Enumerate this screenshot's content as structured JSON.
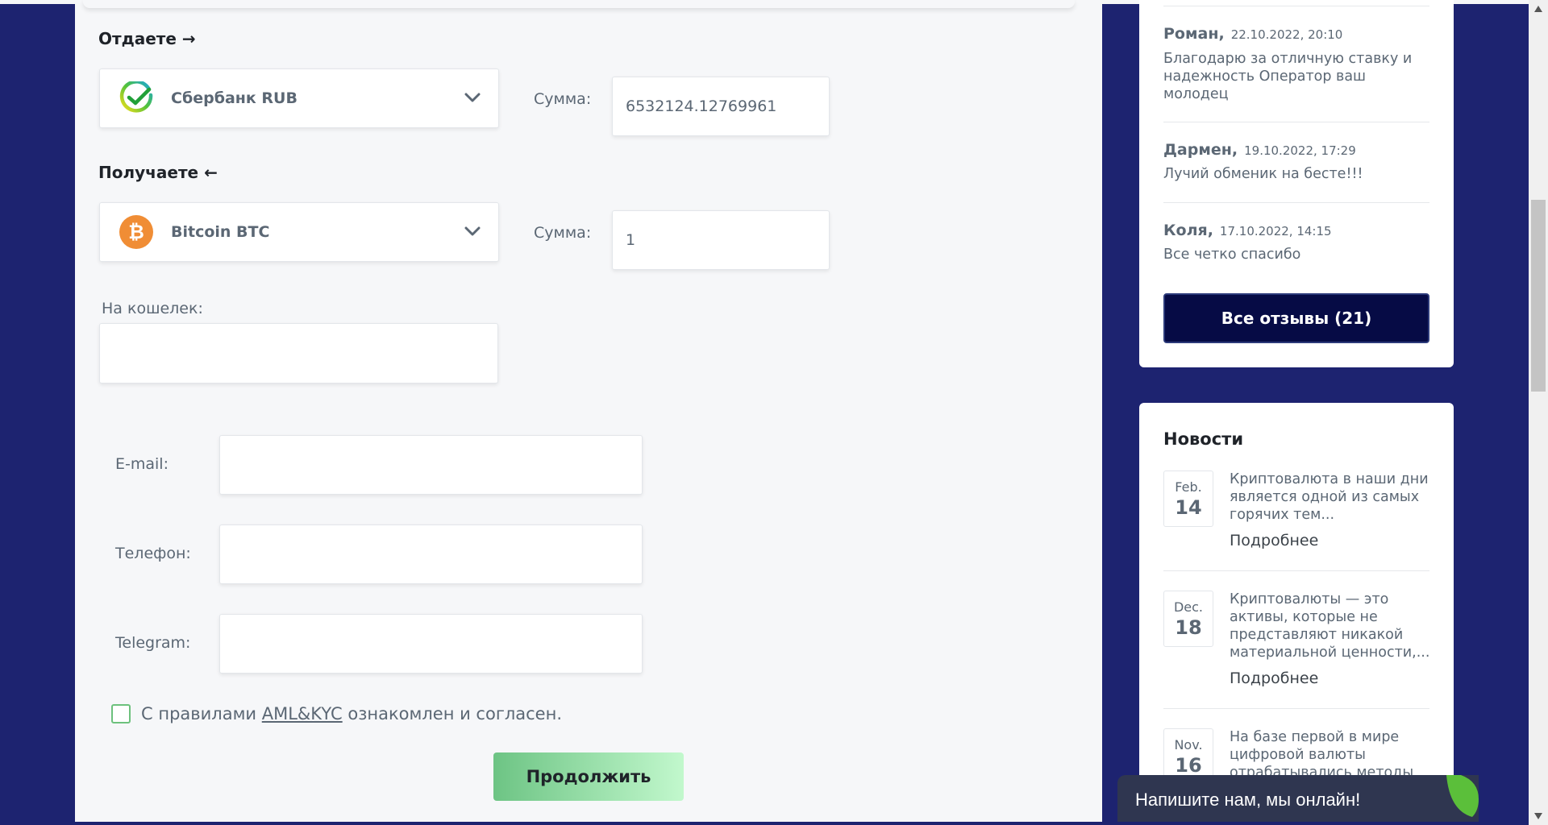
{
  "exchange": {
    "give_label": "Отдаете →",
    "give_currency": "Сбербанк RUB",
    "give_sum_label": "Сумма:",
    "give_sum_value": "6532124.12769961",
    "get_label": "Получаете ←",
    "get_currency": "Bitcoin BTC",
    "get_sum_label": "Сумма:",
    "get_sum_value": "1",
    "wallet_label": "На кошелек:",
    "email_label": "E-mail:",
    "phone_label": "Телефон:",
    "telegram_label": "Telegram:",
    "agree_prefix": "С правилами ",
    "agree_link": "AML&KYC",
    "agree_suffix": " ознакомлен и согласен.",
    "continue_label": "Продолжить"
  },
  "reviews": {
    "items": [
      {
        "name": "Роман,",
        "date": "22.10.2022, 20:10",
        "text": "Благодарю за отличную ставку и надежность Оператор ваш молодец"
      },
      {
        "name": "Дармен,",
        "date": "19.10.2022, 17:29",
        "text": "Лучий обменик на бесте!!!"
      },
      {
        "name": "Коля,",
        "date": "17.10.2022, 14:15",
        "text": "Все четко спасибо"
      }
    ],
    "all_button": "Все отзывы (21)"
  },
  "news": {
    "title": "Новости",
    "more_label": "Подробнее",
    "items": [
      {
        "month": "Feb.",
        "day": "14",
        "text": "Криптовалюта в наши дни является одной из самых горячих тем..."
      },
      {
        "month": "Dec.",
        "day": "18",
        "text": "Криптовалюты — это активы, которые не представляют никакой материальной ценности,..."
      },
      {
        "month": "Nov.",
        "day": "16",
        "text": "На базе первой в мире цифровой валюты отрабатывались методы"
      }
    ]
  },
  "chat": {
    "label": "Напишите нам, мы онлайн!"
  },
  "colors": {
    "background": "#1d2370",
    "accent_green": "#6dc484",
    "button_dark": "#060b45"
  }
}
